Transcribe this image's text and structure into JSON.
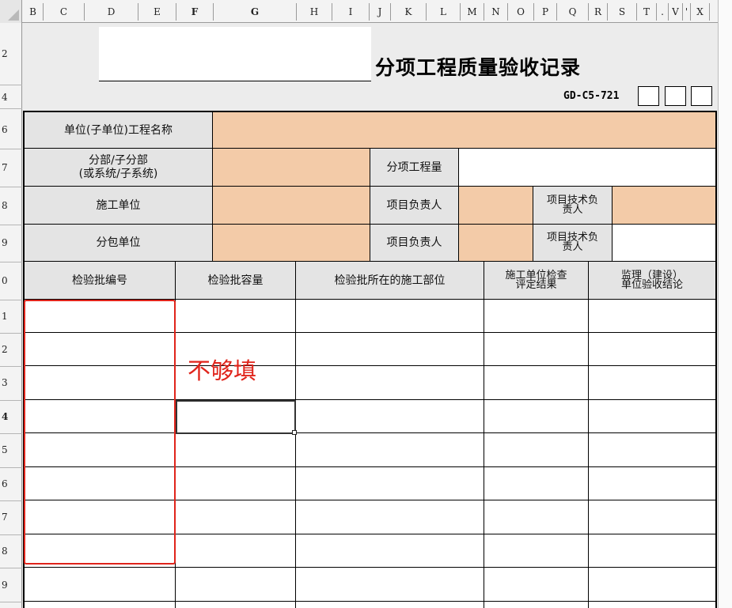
{
  "columns": [
    "B",
    "C",
    "D",
    "E",
    "F",
    "G",
    "H",
    "I",
    "J",
    "K",
    "L",
    "M",
    "N",
    "O",
    "P",
    "Q",
    "R",
    "S",
    "T",
    ".",
    "V",
    "'",
    "X"
  ],
  "rows": [
    "2",
    "4",
    "6",
    "7",
    "8",
    "9",
    "0",
    "1",
    "2",
    "3",
    "4",
    "5",
    "6",
    "7",
    "8",
    "9"
  ],
  "title": "分项工程质量验收记录",
  "form_code": "GD-C5-721",
  "form": {
    "unit_project_name": "单位(子单位)工程名称",
    "sub_division_line1": "分部/子分部",
    "sub_division_line2": "(或系统/子系统)",
    "item_quantity": "分项工程量",
    "construction_unit": "施工单位",
    "project_manager": "项目负责人",
    "tech_lead_line1": "项目技术负",
    "tech_lead_line2": "责人",
    "subcontractor": "分包单位",
    "project_manager_2": "项目负责人",
    "tech_lead2_line1": "项目技术负",
    "tech_lead2_line2": "责人"
  },
  "table_headers": {
    "batch_no": "检验批编号",
    "batch_capacity": "检验批容量",
    "batch_location": "检验批所在的施工部位",
    "inspect_line1": "施工单位检查",
    "inspect_line2": "评定结果",
    "supervise_line1": "监理（建设）",
    "supervise_line2": "单位验收结论"
  },
  "annotation": "不够填",
  "colors": {
    "label_bg": "#e4e4e4",
    "input_orange": "#f3cba8",
    "annotation_red": "#e0241b"
  }
}
